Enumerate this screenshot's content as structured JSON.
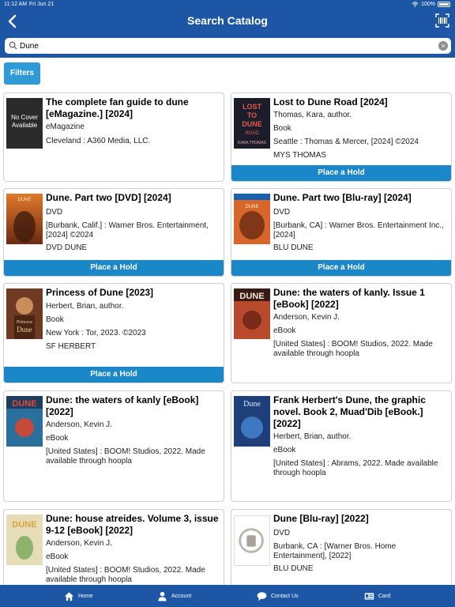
{
  "status": {
    "time": "11:12 AM",
    "date": "Fri Jun 21",
    "battery": "100%"
  },
  "header": {
    "title": "Search Catalog"
  },
  "search": {
    "value": "Dune"
  },
  "filters_label": "Filters",
  "hold_label": "Place a Hold",
  "results": [
    {
      "title": "The complete fan guide to dune [eMagazine.] [2024]",
      "lines": [
        "eMagazine",
        "Cleveland : A360 Media, LLC."
      ],
      "cover_text": "No Cover Available"
    },
    {
      "title": "Lost to Dune Road [2024]",
      "lines": [
        "Thomas, Kara, author.",
        "Book",
        "Seattle : Thomas & Mercer, [2024] ©2024",
        "MYS THOMAS"
      ],
      "cover_text": "LOST TO DUNE ROAD KARA THOMAS"
    },
    {
      "title": "Dune. Part two [DVD] [2024]",
      "lines": [
        "DVD",
        "[Burbank, Calif.] : Warner Bros. Entertainment, [2024] ©2024",
        "DVD DUNE"
      ],
      "cover_text": "DUNE"
    },
    {
      "title": "Dune. Part two [Blu-ray] [2024]",
      "lines": [
        "DVD",
        "[Burbank, CA] : Warner Bros. Entertainment Inc., [2024]",
        "BLU DUNE"
      ],
      "cover_text": "DUNE"
    },
    {
      "title": "Princess of Dune [2023]",
      "lines": [
        "Herbert, Brian, author.",
        "Book",
        "New York : Tor, 2023. ©2023",
        "SF HERBERT"
      ],
      "cover_text": "Princess of Dune"
    },
    {
      "title": "Dune: the waters of kanly. Issue 1 [eBook] [2022]",
      "lines": [
        "Anderson, Kevin J.",
        "eBook",
        "[United States] : BOOM! Studios, 2022. Made available through hoopla"
      ],
      "cover_text": "DUNE"
    },
    {
      "title": "Dune: the waters of kanly [eBook] [2022]",
      "lines": [
        "Anderson, Kevin J.",
        "eBook",
        "[United States] : BOOM! Studios, 2022. Made available through hoopla"
      ],
      "cover_text": "DUNE"
    },
    {
      "title": "Frank Herbert's Dune, the graphic novel. Book 2, Muad'Dib [eBook.] [2022]",
      "lines": [
        "Herbert, Brian, author.",
        "eBook",
        "[United States] : Abrams, 2022. Made available through hoopla"
      ],
      "cover_text": "Dune"
    },
    {
      "title": "Dune: house atreides. Volume 3, issue 9-12 [eBook] [2022]",
      "lines": [
        "Anderson, Kevin J.",
        "eBook",
        "[United States] : BOOM! Studios, 2022. Made available through hoopla"
      ],
      "cover_text": "DUNE"
    },
    {
      "title": "Dune [Blu-ray] [2022]",
      "lines": [
        "DVD",
        "Burbank, CA : [Warner Bros. Home Entertainment], [2022]",
        "BLU DUNE"
      ],
      "cover_text": ""
    }
  ],
  "tabs": [
    {
      "label": "Home",
      "icon": "home-icon"
    },
    {
      "label": "Account",
      "icon": "person-icon"
    },
    {
      "label": "Contact Us",
      "icon": "chat-bubble-icon"
    },
    {
      "label": "Card",
      "icon": "library-card-icon"
    }
  ],
  "colors": {
    "header": "#1c56a4",
    "button": "#1a87c9",
    "filters": "#2f9ad8"
  }
}
